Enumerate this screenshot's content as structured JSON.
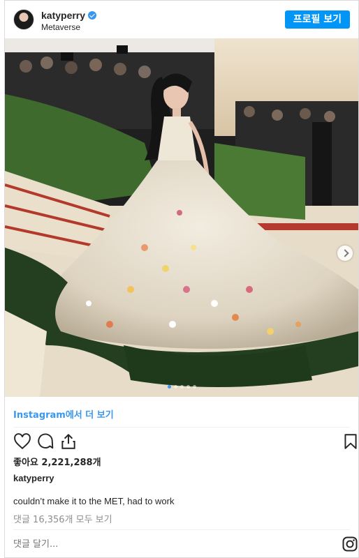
{
  "header": {
    "username": "katyperry",
    "location": "Metaverse",
    "profile_button": "프로필 보기"
  },
  "carousel": {
    "slide_count": 5,
    "active_index": 0
  },
  "view_more_link": "Instagram에서 더 보기",
  "actions": {
    "like": "heart-icon",
    "comment": "comment-icon",
    "share": "share-icon",
    "save": "bookmark-icon"
  },
  "likes": "좋아요 2,221,288개",
  "caption": {
    "username": "katyperry",
    "text": "couldn’t make it to the MET, had to work"
  },
  "comments_link": "댓글 16,356개 모두 보기",
  "comment_placeholder": "댓글 달기...",
  "colors": {
    "accent": "#0095f6",
    "link": "#3897f0",
    "muted": "#8e8e8e"
  }
}
